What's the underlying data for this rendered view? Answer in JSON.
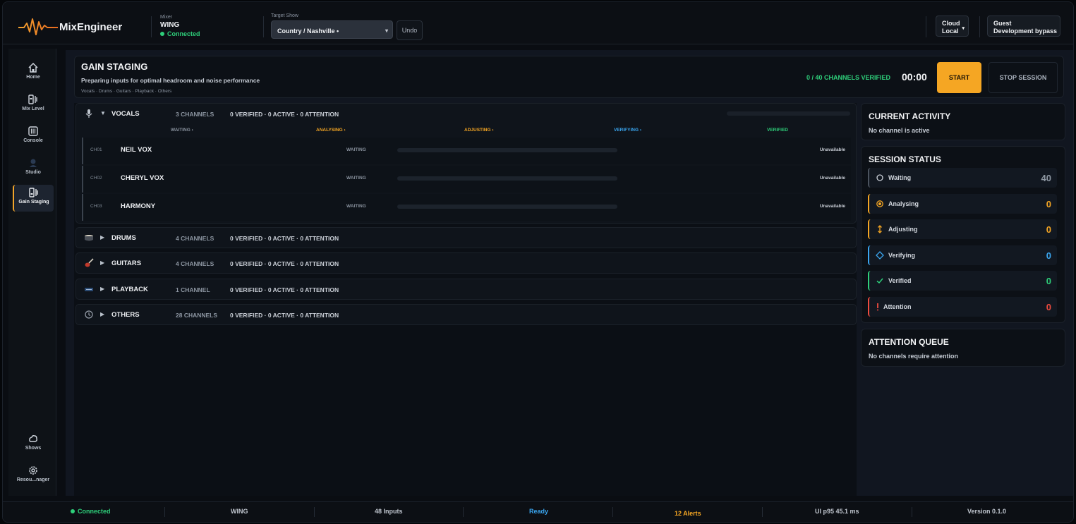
{
  "app": {
    "brand": "MixEngineer",
    "mixer_label": "Mixer",
    "mixer_name": "WING",
    "mixer_status": "Connected",
    "target_show_label": "Target Show",
    "target_show_value": "Country / Nashville •",
    "undo_label": "Undo",
    "cloud_line1": "Cloud",
    "cloud_line2": "Local",
    "guest_line1": "Guest",
    "guest_line2": "Development bypass"
  },
  "nav": {
    "items": [
      {
        "label": "Home",
        "icon": "home-icon"
      },
      {
        "label": "Mix Level",
        "icon": "mix-level-icon"
      },
      {
        "label": "Console",
        "icon": "console-icon"
      },
      {
        "label": "Studio",
        "icon": "studio-icon"
      },
      {
        "label": "Gain Staging",
        "icon": "gain-staging-icon"
      },
      {
        "label": "Shows",
        "icon": "shows-icon"
      },
      {
        "label": "Resou...nager",
        "icon": "gear-icon"
      }
    ]
  },
  "header": {
    "title": "GAIN STAGING",
    "subtitle": "Preparing inputs for optimal headroom and noise performance",
    "crumbs": "Vocals · Drums · Guitars · Playback · Others",
    "verified_count": "0 / 40 CHANNELS VERIFIED",
    "timer": "00:00",
    "start_label": "START",
    "stop_label": "STOP SESSION"
  },
  "stages": {
    "waiting": "WAITING ›",
    "analysing": "ANALYSING ›",
    "adjusting": "ADJUSTING ›",
    "verifying": "VERIFYING ›",
    "verified": "VERIFIED"
  },
  "groups": [
    {
      "name": "VOCALS",
      "count": "3 CHANNELS",
      "stats": "0 VERIFIED  ·  0 ACTIVE  ·  0 ATTENTION",
      "icon": "microphone-icon"
    },
    {
      "name": "DRUMS",
      "count": "4 CHANNELS",
      "stats": "0 VERIFIED  ·  0 ACTIVE  ·  0 ATTENTION",
      "icon": "drum-icon"
    },
    {
      "name": "GUITARS",
      "count": "4 CHANNELS",
      "stats": "0 VERIFIED  ·  0 ACTIVE  ·  0 ATTENTION",
      "icon": "guitar-icon"
    },
    {
      "name": "PLAYBACK",
      "count": "1 CHANNEL",
      "stats": "0 VERIFIED  ·  0 ACTIVE  ·  0 ATTENTION",
      "icon": "playback-icon"
    },
    {
      "name": "OTHERS",
      "count": "28 CHANNELS",
      "stats": "0 VERIFIED  ·  0 ACTIVE  ·  0 ATTENTION",
      "icon": "clock-icon"
    }
  ],
  "channels": [
    {
      "id": "CH01",
      "name": "NEIL VOX",
      "state": "WAITING",
      "availability": "Unavailable"
    },
    {
      "id": "CH02",
      "name": "CHERYL VOX",
      "state": "WAITING",
      "availability": "Unavailable"
    },
    {
      "id": "CH03",
      "name": "HARMONY",
      "state": "WAITING",
      "availability": "Unavailable"
    }
  ],
  "current_activity": {
    "title": "CURRENT ACTIVITY",
    "text": "No channel is active"
  },
  "session_status": {
    "title": "SESSION STATUS",
    "rows": [
      {
        "label": "Waiting",
        "value": "40",
        "color": "#8f98a3"
      },
      {
        "label": "Analysing",
        "value": "0",
        "color": "#f5a623"
      },
      {
        "label": "Adjusting",
        "value": "0",
        "color": "#f5a623"
      },
      {
        "label": "Verifying",
        "value": "0",
        "color": "#3aa6f0"
      },
      {
        "label": "Verified",
        "value": "0",
        "color": "#2ecf7a"
      },
      {
        "label": "Attention",
        "value": "0",
        "color": "#ef4b3f"
      }
    ]
  },
  "attention_queue": {
    "title": "ATTENTION QUEUE",
    "text": "No channels require attention"
  },
  "statusbar": {
    "connection": "Connected",
    "mixer": "WING",
    "inputs": "48 Inputs",
    "state": "Ready",
    "alerts": "12 Alerts",
    "perf": "UI p95 45.1 ms",
    "version": "Version 0.1.0"
  },
  "colors": {
    "accent": "#f5a623",
    "success": "#2ecf7a",
    "info": "#3aa6f0",
    "danger": "#ef4b3f"
  }
}
